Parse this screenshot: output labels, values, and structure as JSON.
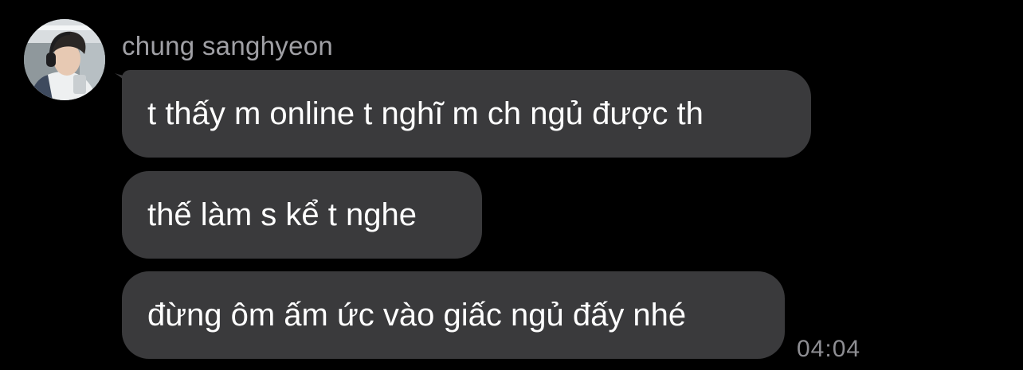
{
  "chat": {
    "sender": {
      "name": "chung sanghyeon",
      "avatar": "profile-photo"
    },
    "messages": [
      {
        "text": "t thấy m online t nghĩ m ch ngủ được th"
      },
      {
        "text": "thế làm s kể t nghe"
      },
      {
        "text": "đừng ôm ấm ức vào giấc ngủ đấy nhé"
      }
    ],
    "timestamp": "04:04"
  },
  "colors": {
    "background": "#000000",
    "bubble": "#3a3a3c",
    "message_text": "#ffffff",
    "secondary_text": "#a0a0a5"
  }
}
